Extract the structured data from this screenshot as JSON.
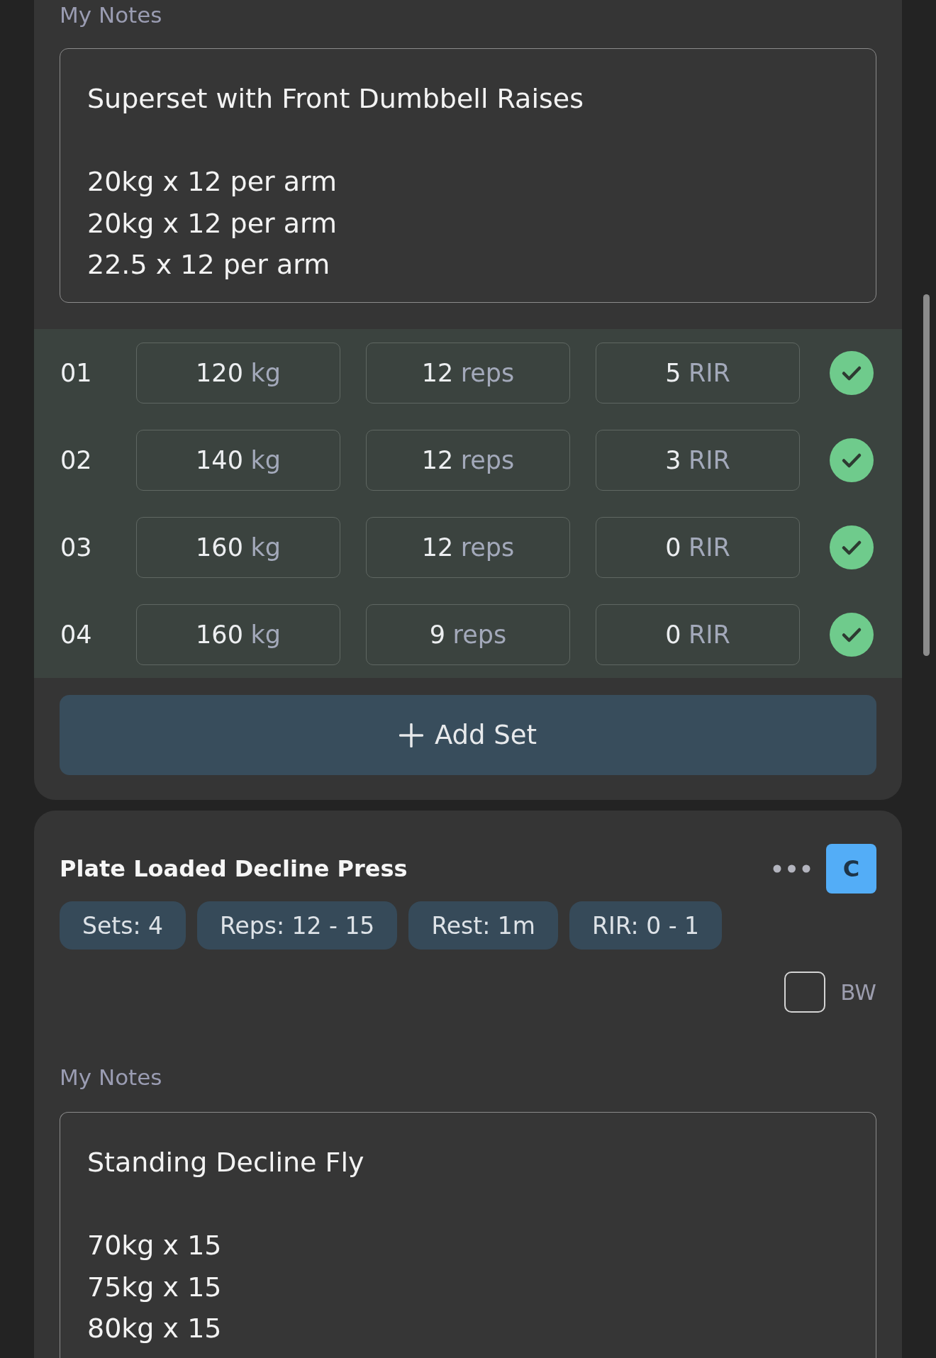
{
  "exercises": [
    {
      "notes_label": "My Notes",
      "notes": "Superset with Front Dumbbell Raises\n\n20kg x 12 per arm\n20kg x 12 per arm\n22.5 x 12 per arm",
      "sets": [
        {
          "number": "01",
          "fields": [
            {
              "value": "120",
              "unit": "kg"
            },
            {
              "value": "12",
              "unit": "reps"
            },
            {
              "value": "5",
              "unit": "RIR"
            }
          ],
          "completed": true
        },
        {
          "number": "02",
          "fields": [
            {
              "value": "140",
              "unit": "kg"
            },
            {
              "value": "12",
              "unit": "reps"
            },
            {
              "value": "3",
              "unit": "RIR"
            }
          ],
          "completed": true
        },
        {
          "number": "03",
          "fields": [
            {
              "value": "160",
              "unit": "kg"
            },
            {
              "value": "12",
              "unit": "reps"
            },
            {
              "value": "0",
              "unit": "RIR"
            }
          ],
          "completed": true
        },
        {
          "number": "04",
          "fields": [
            {
              "value": "160",
              "unit": "kg"
            },
            {
              "value": "9",
              "unit": "reps"
            },
            {
              "value": "0",
              "unit": "RIR"
            }
          ],
          "completed": true
        }
      ],
      "add_set_label": "Add Set"
    },
    {
      "title": "Plate Loaded Decline Press",
      "group_letter": "C",
      "targets": [
        "Sets: 4",
        "Reps: 12 - 15",
        "Rest: 1m",
        "RIR: 0 - 1"
      ],
      "bodyweight": {
        "label": "BW",
        "checked": false
      },
      "notes_label": "My Notes",
      "notes": "Standing Decline Fly\n\n70kg x 15\n75kg x 15\n80kg x 15"
    }
  ]
}
